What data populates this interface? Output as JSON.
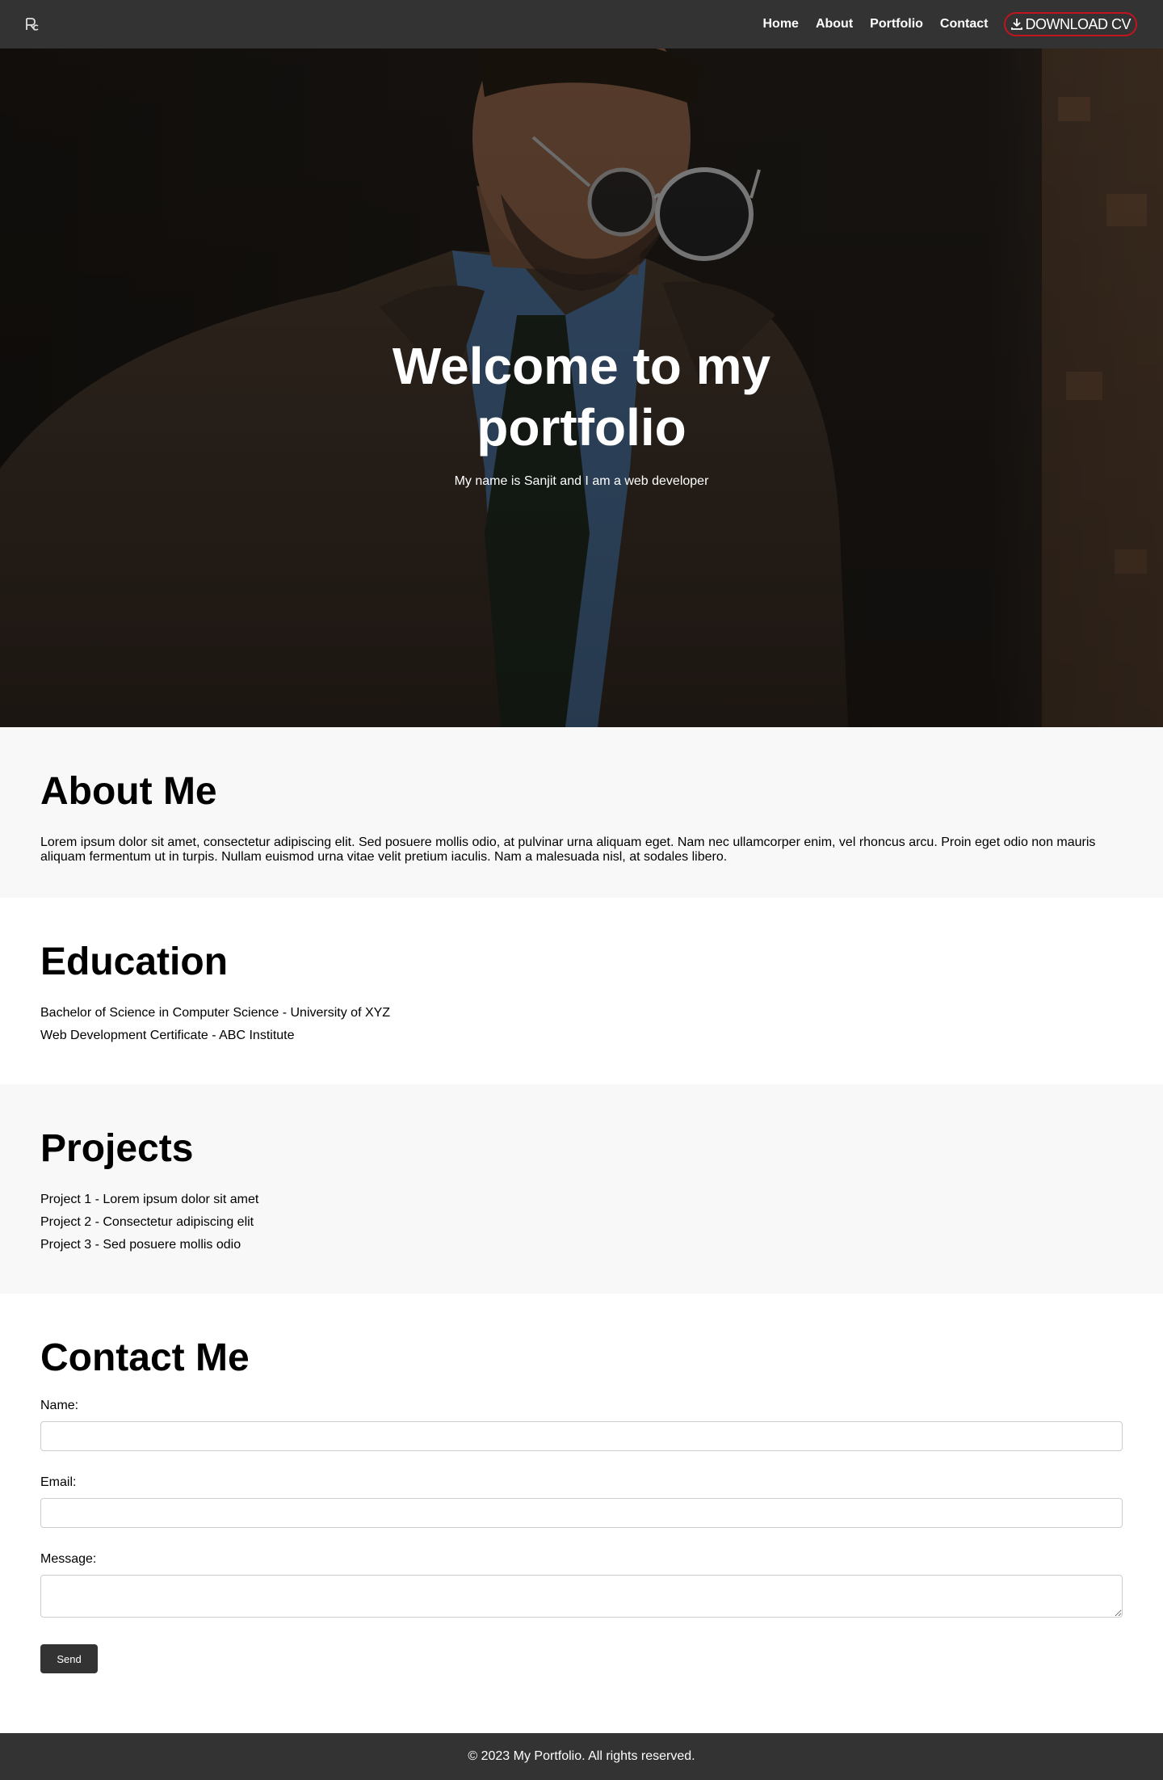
{
  "nav": {
    "logo_icon": "rc-monogram-icon",
    "links": [
      "Home",
      "About",
      "Portfolio",
      "Contact"
    ],
    "cv_button": "DOWNLOAD CV",
    "cv_icon": "download-icon",
    "accent_color": "#c0141f"
  },
  "hero": {
    "title": "Welcome to my portfolio",
    "subtitle": "My name is Sanjit and I am a web developer"
  },
  "about": {
    "title": "About Me",
    "text": "Lorem ipsum dolor sit amet, consectetur adipiscing elit. Sed posuere mollis odio, at pulvinar urna aliquam eget. Nam nec ullamcorper enim, vel rhoncus arcu. Proin eget odio non mauris aliquam fermentum ut in turpis. Nullam euismod urna vitae velit pretium iaculis. Nam a malesuada nisl, at sodales libero."
  },
  "education": {
    "title": "Education",
    "items": [
      "Bachelor of Science in Computer Science - University of XYZ",
      "Web Development Certificate - ABC Institute"
    ]
  },
  "projects": {
    "title": "Projects",
    "items": [
      "Project 1 - Lorem ipsum dolor sit amet",
      "Project 2 - Consectetur adipiscing elit",
      "Project 3 - Sed posuere mollis odio"
    ]
  },
  "contact": {
    "title": "Contact Me",
    "name_label": "Name:",
    "email_label": "Email:",
    "message_label": "Message:",
    "send_label": "Send"
  },
  "footer": {
    "text": "© 2023 My Portfolio. All rights reserved."
  }
}
